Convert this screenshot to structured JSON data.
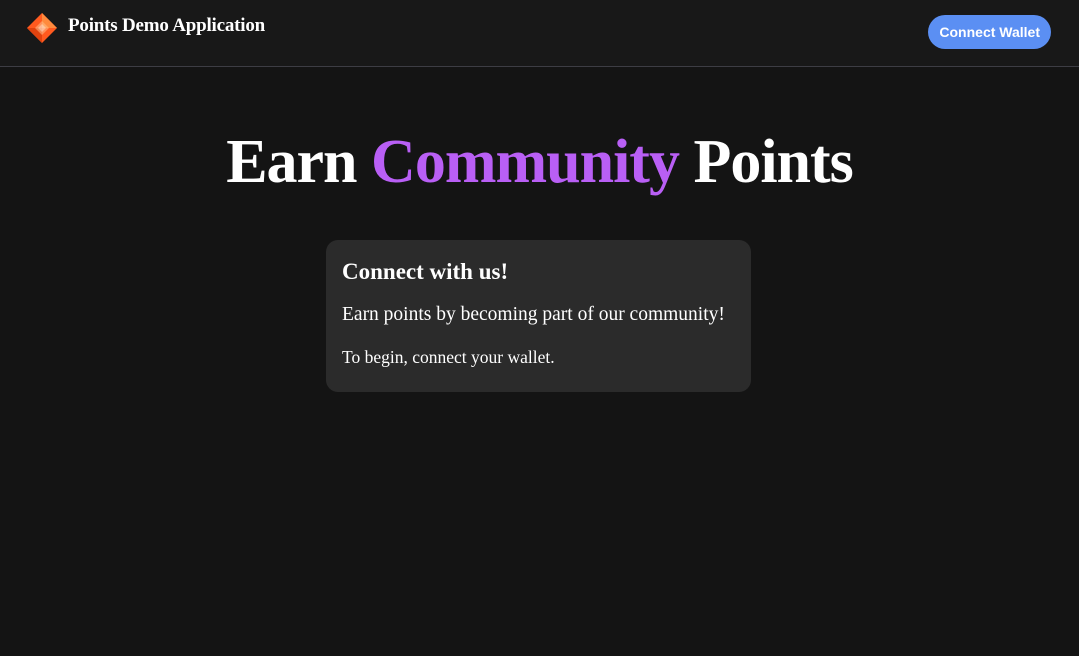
{
  "header": {
    "logo_icon": "diamond-logo-icon",
    "title": "Points Demo Application",
    "connect_button_label": "Connect Wallet"
  },
  "hero": {
    "prefix": "Earn ",
    "accent": "Community",
    "suffix": " Points"
  },
  "card": {
    "title": "Connect with us!",
    "text_1": "Earn points by becoming part of our community!",
    "text_2": "To begin, connect your wallet."
  },
  "colors": {
    "background": "#141414",
    "header_background": "#181818",
    "card_background": "#2b2b2b",
    "accent_purple": "#b95ff5",
    "button_blue": "#5b8ff3",
    "logo_orange": "#ff5a1f"
  }
}
